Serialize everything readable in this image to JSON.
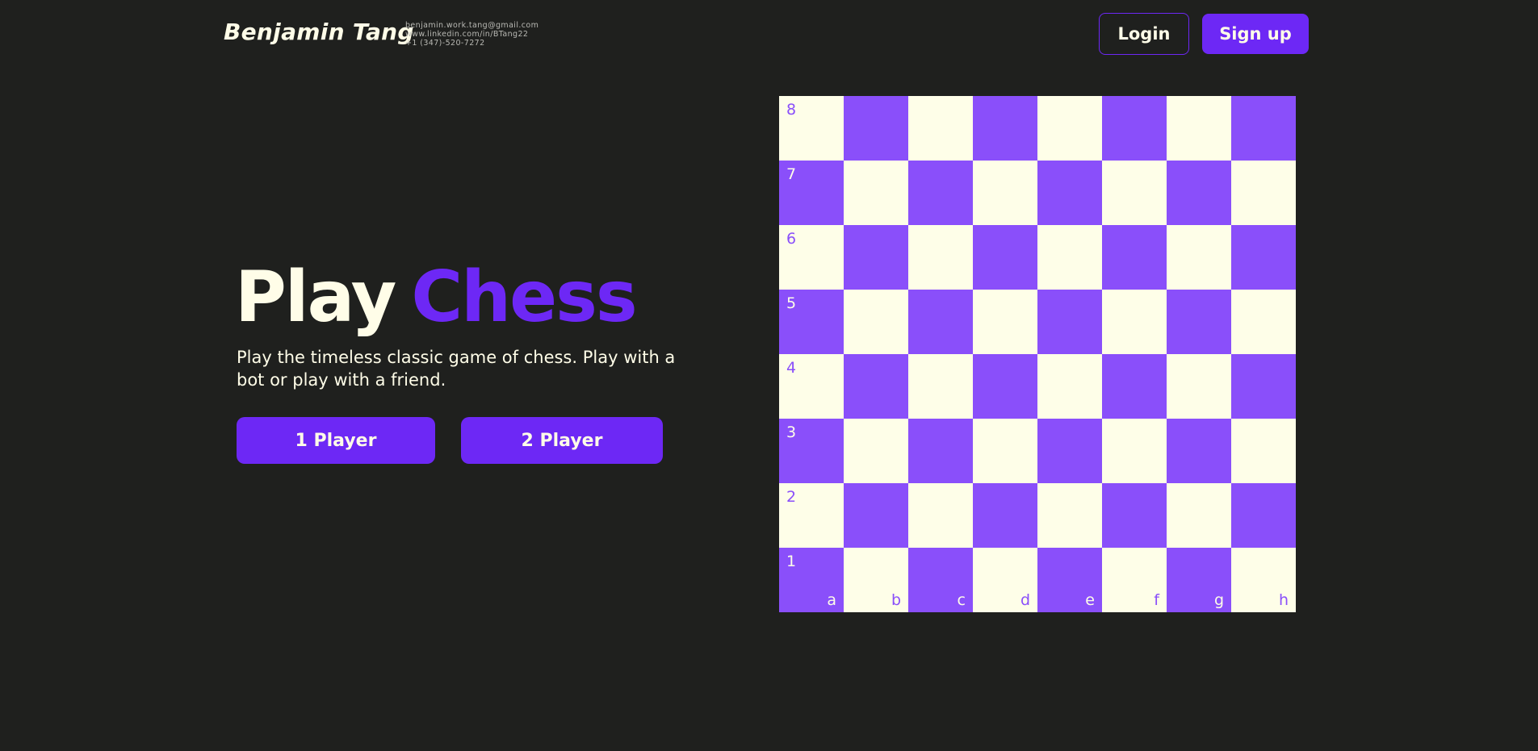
{
  "header": {
    "brand_name": "Benjamin Tang",
    "contact": {
      "email": "benjamin.work.tang@gmail.com",
      "linkedin": "www.linkedin.com/in/BTang22",
      "phone": "+1 (347)-520-7272"
    },
    "login_label": "Login",
    "signup_label": "Sign up"
  },
  "hero": {
    "title_part1": "Play",
    "title_part2": "Chess",
    "description": "Play the timeless classic game of chess. Play with a bot or play with a friend.",
    "one_player_label": "1 Player",
    "two_player_label": "2 Player"
  },
  "board": {
    "ranks": [
      "8",
      "7",
      "6",
      "5",
      "4",
      "3",
      "2",
      "1"
    ],
    "files": [
      "a",
      "b",
      "c",
      "d",
      "e",
      "f",
      "g",
      "h"
    ],
    "light_color": "#fefee8",
    "dark_color": "#8a4ffa"
  },
  "colors": {
    "background": "#1f201e",
    "accent": "#6d28f5",
    "text": "#fffde8"
  }
}
